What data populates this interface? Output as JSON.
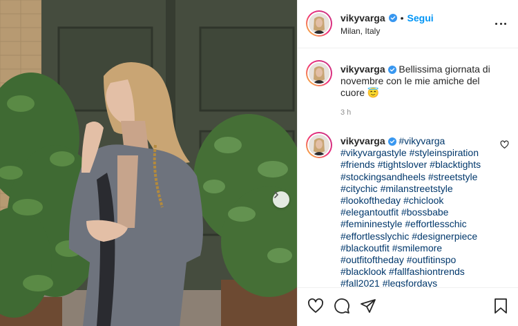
{
  "post": {
    "username": "vikyvarga",
    "follow_label": "Segui",
    "separator": "•",
    "location": "Milan, Italy"
  },
  "caption": {
    "username": "vikyvarga",
    "text": "Bellissima giornata di novembre con le mie amiche del cuore",
    "emoji": "😇",
    "time": "3 h"
  },
  "comment": {
    "username": "vikyvarga",
    "first_tag": "#vikyvarga",
    "tags": "#vikyvargastyle #styleinspiration #friends #tightslover #blacktights #stockingsandheels #streetstyle #citychic #milanstreetstyle #lookoftheday #chiclook #elegantoutfit #bossbabe #femininestyle #effortlesschic #effortlesslychic #designerpiece #blackoutfit #smilemore #outfitoftheday #outfitinspo #blacklook #fallfashiontrends #fall2021 #legsfordays"
  },
  "icons": {
    "verified": "verified-badge-icon",
    "more": "more-options-icon",
    "like": "heart-icon",
    "comment": "comment-icon",
    "share": "send-icon",
    "save": "bookmark-icon",
    "next": "chevron-right-icon"
  },
  "colors": {
    "accent": "#0095f6",
    "verified": "#3897f0",
    "hashtag": "#00376b",
    "muted": "#8e8e8e"
  }
}
